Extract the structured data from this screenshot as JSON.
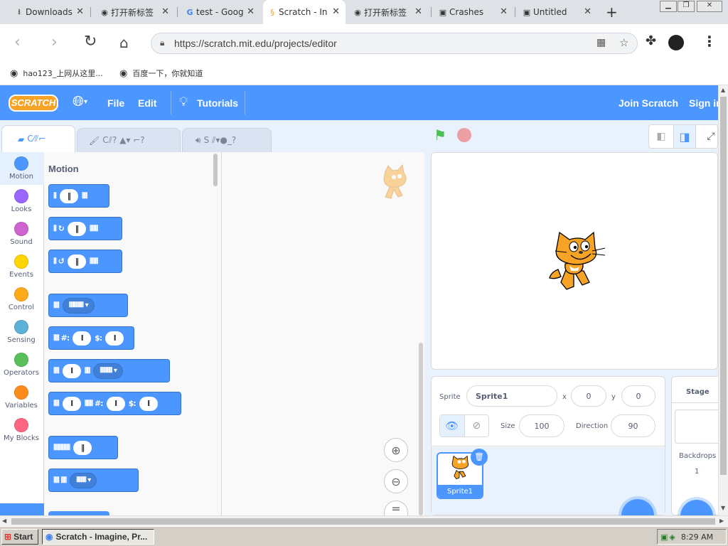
{
  "browser": {
    "tabs": [
      {
        "title": "Downloads",
        "icon": "download-icon"
      },
      {
        "title": "打开新标签",
        "icon": "globe-icon"
      },
      {
        "title": "test - Goog",
        "icon": "google-icon"
      },
      {
        "title": "Scratch - In",
        "icon": "scratch-icon",
        "active": true
      },
      {
        "title": "打开新标签",
        "icon": "globe-icon"
      },
      {
        "title": "Crashes",
        "icon": "folder-icon"
      },
      {
        "title": "Untitled",
        "icon": "folder-icon"
      }
    ],
    "new_tab": "+",
    "url": "https://scratch.mit.edu/projects/editor",
    "bookmarks": [
      "hao123_上网从这里...",
      "百度一下，你就知道"
    ]
  },
  "scratch": {
    "menu": {
      "logo": "SCRATCH",
      "file": "File",
      "edit": "Edit",
      "tutorials": "Tutorials",
      "join": "Join Scratch",
      "signin": "Sign in"
    },
    "tabs": [
      "C⁄⫽⌐",
      "C⫽? ▲▾ ⌐?",
      "S ⫽▾●_?"
    ],
    "categories": [
      {
        "label": "Motion",
        "color": "#4c97ff"
      },
      {
        "label": "Looks",
        "color": "#9966ff"
      },
      {
        "label": "Sound",
        "color": "#cf63cf"
      },
      {
        "label": "Events",
        "color": "#ffd500"
      },
      {
        "label": "Control",
        "color": "#ffab19"
      },
      {
        "label": "Sensing",
        "color": "#5cb1d6"
      },
      {
        "label": "Operators",
        "color": "#59c059"
      },
      {
        "label": "Variables",
        "color": "#ff8c1a"
      },
      {
        "label": "My Blocks",
        "color": "#ff6680"
      }
    ],
    "palette_title": "Motion",
    "blocks": [
      {
        "pre": "⦀",
        "pill": "‖",
        "post": "⦀⦀"
      },
      {
        "pre": "⦀ ↻",
        "pill": "‖",
        "post": "⦀⦀⦀"
      },
      {
        "pre": "⦀ ↺",
        "pill": "‖",
        "post": "⦀⦀⦀"
      },
      {
        "pre": "⦀⦀",
        "dd": "⦀⦀⦀⦀⦀⦀ ▾"
      },
      {
        "pre": "⦀⦀ #:",
        "pill": "I",
        "mid": "$:",
        "pill2": "I"
      },
      {
        "pre": "⦀⦀",
        "pill": "I",
        "mid": "⦀⦀",
        "dd": "⦀⦀⦀⦀⦀ ▾"
      },
      {
        "pre": "⦀⦀",
        "pill": "I",
        "mid": "⦀⦀⦀ #:",
        "pill2": "I",
        "mid2": "$:",
        "pill3": "I"
      },
      {
        "pre": "⦀⦀⦀⦀⦀⦀",
        "pill": "‖"
      },
      {
        "pre": "⦀⦀ ⦀⦀",
        "dd": "⦀⦀⦀⦀ ▾"
      }
    ],
    "sprite_info": {
      "sprite_label": "Sprite",
      "sprite_name": "Sprite1",
      "x_label": "x",
      "x": "0",
      "y_label": "y",
      "y": "0",
      "size_label": "Size",
      "size": "100",
      "direction_label": "Direction",
      "direction": "90"
    },
    "sprite_tile": "Sprite1",
    "stage_panel": {
      "title": "Stage",
      "backdrops_label": "Backdrops",
      "backdrops_count": "1"
    },
    "colors": {
      "accent": "#4c97ff",
      "menu": "#4c97ff"
    }
  },
  "taskbar": {
    "start": "Start",
    "window": "Scratch - Imagine, Pr...",
    "time": "8:29 AM"
  }
}
